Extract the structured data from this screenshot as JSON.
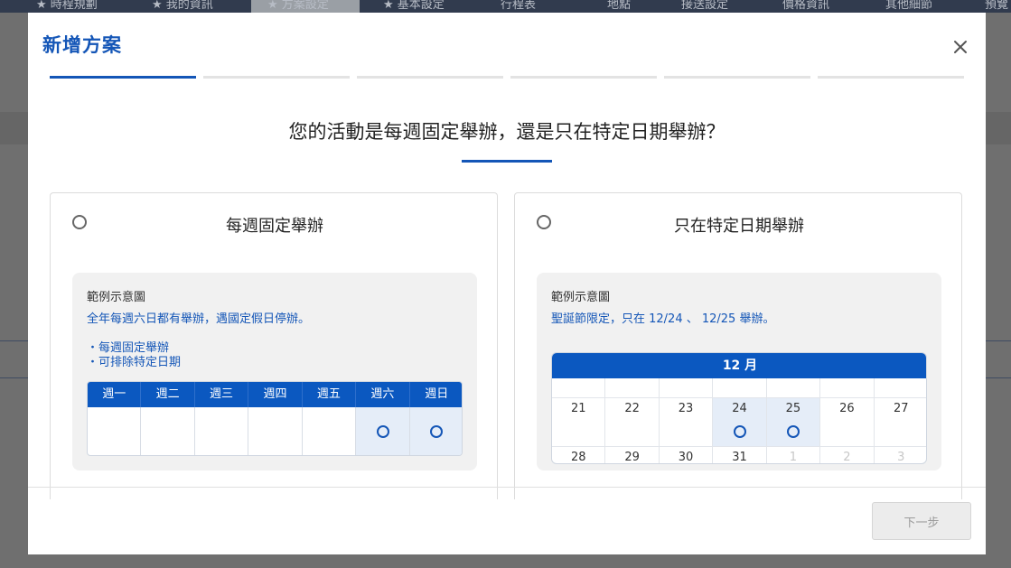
{
  "background": {
    "nav_items": [
      "★ 時程規劃",
      "★ 我的資訊",
      "★ 方案設定",
      "★ 基本設定",
      "行程表",
      "地點",
      "接送設定",
      "價格資訊",
      "其他細節",
      "預覽"
    ]
  },
  "modal": {
    "title": "新增方案",
    "close_icon": "close-icon",
    "steps": [
      true,
      false,
      false,
      false,
      false,
      false
    ],
    "question": "您的活動是每週固定舉辦，還是只在特定日期舉辦？",
    "next_button": "下一步"
  },
  "weekly_option": {
    "title": "每週固定舉辦",
    "example_label": "範例示意圖",
    "example_desc": "全年每週六日都有舉辦，遇國定假日停辦。",
    "bullets": [
      "・每週固定舉辦",
      "・可排除特定日期"
    ],
    "weekdays": [
      "週一",
      "週二",
      "週三",
      "週四",
      "週五",
      "週六",
      "週日"
    ],
    "highlighted": [
      false,
      false,
      false,
      false,
      false,
      true,
      true
    ]
  },
  "date_option": {
    "title": "只在特定日期舉辦",
    "example_label": "範例示意圖",
    "example_desc": "聖誕節限定，只在 12/24 、 12/25 舉辦。",
    "month": "12 月",
    "rows": [
      [
        "",
        "",
        "",
        "",
        "",
        "",
        ""
      ],
      [
        "21",
        "22",
        "23",
        "24",
        "25",
        "26",
        "27"
      ],
      [
        "28",
        "29",
        "30",
        "31",
        "1",
        "2",
        "3"
      ]
    ],
    "highlighted_dates": [
      "24",
      "25"
    ],
    "muted_dates": [
      "1",
      "2",
      "3"
    ]
  },
  "colors": {
    "accent": "#1456b7",
    "header_blue": "#0b58c0",
    "highlight_cell": "#e5edf8"
  }
}
